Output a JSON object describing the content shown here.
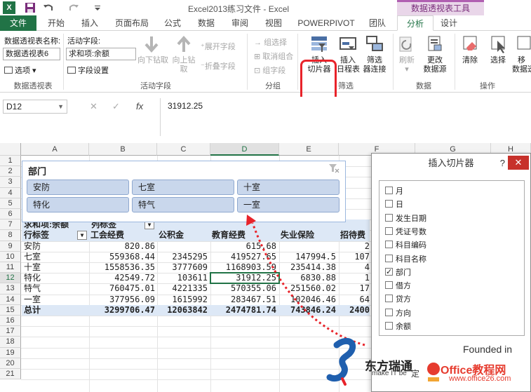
{
  "window": {
    "title": "Excel2013练习文件 - Excel",
    "context_tool": "数据透视表工具"
  },
  "tabs": [
    {
      "label": "文件"
    },
    {
      "label": "开始"
    },
    {
      "label": "插入"
    },
    {
      "label": "页面布局"
    },
    {
      "label": "公式"
    },
    {
      "label": "数据"
    },
    {
      "label": "审阅"
    },
    {
      "label": "视图"
    },
    {
      "label": "POWERPIVOT"
    },
    {
      "label": "团队"
    },
    {
      "label": "分析"
    },
    {
      "label": "设计"
    }
  ],
  "ribbon": {
    "pivot_name_label": "数据透视表名称:",
    "pivot_name_value": "数据透视表6",
    "options_label": "选项",
    "group_pivot": "数据透视表",
    "active_field_label": "活动字段:",
    "active_field_value": "求和项:余额",
    "field_settings": "字段设置",
    "drill_down": "向下钻取",
    "drill_up": "向上钻",
    "drill_up_2": "取",
    "expand_field": "展开字段",
    "collapse_field": "折叠字段",
    "group_active_field": "活动字段",
    "group_selection": "组选择",
    "ungroup": "取消组合",
    "group_field": "组字段",
    "group_group": "分组",
    "insert_slicer_1": "插入",
    "insert_slicer_2": "切片器",
    "insert_timeline_1": "插入",
    "insert_timeline_2": "日程表",
    "filter_conn_1": "筛选",
    "filter_conn_2": "器连接",
    "group_filter": "筛选",
    "refresh": "刷新",
    "change_source_1": "更改",
    "change_source_2": "数据源",
    "group_data": "数据",
    "clear": "清除",
    "select": "选择",
    "move_1": "移",
    "move_2": "数据透",
    "group_actions": "操作"
  },
  "formula_bar": {
    "name_box": "D12",
    "fx": "fx",
    "formula": "31912.25"
  },
  "columns": [
    "A",
    "B",
    "C",
    "D",
    "E",
    "F",
    "G",
    "H"
  ],
  "rows": [
    "1",
    "2",
    "3",
    "4",
    "5",
    "6",
    "7",
    "8",
    "9",
    "10",
    "11",
    "12",
    "13",
    "14",
    "15",
    "16",
    "17",
    "18",
    "19",
    "20",
    "21"
  ],
  "slicer": {
    "title": "部门",
    "items": [
      "安防",
      "七室",
      "十室",
      "特化",
      "特气",
      "一室"
    ]
  },
  "pivot": {
    "value_label": "求和项:余额",
    "col_label": "列标签",
    "row_label": "行标签",
    "headers": [
      "工会经费",
      "公积金",
      "教育经费",
      "失业保险",
      "招待费"
    ],
    "rows": [
      {
        "name": "安防",
        "values": [
          "820.86",
          "",
          "615.68",
          "",
          "2"
        ]
      },
      {
        "name": "七室",
        "values": [
          "559368.44",
          "2345295",
          "419527.65",
          "147994.5",
          "107"
        ]
      },
      {
        "name": "十室",
        "values": [
          "1558536.35",
          "3777609",
          "1168903.59",
          "235414.38",
          "4"
        ]
      },
      {
        "name": "特化",
        "values": [
          "42549.72",
          "103611",
          "31912.25",
          "6830.88",
          "1"
        ]
      },
      {
        "name": "特气",
        "values": [
          "760475.01",
          "4221335",
          "570355.06",
          "251560.02",
          "17"
        ]
      },
      {
        "name": "一室",
        "values": [
          "377956.09",
          "1615992",
          "283467.51",
          "102046.46",
          "64"
        ]
      }
    ],
    "total": {
      "name": "总计",
      "values": [
        "3299706.47",
        "12063842",
        "2474781.74",
        "743846.24",
        "2400"
      ]
    }
  },
  "dialog": {
    "title": "插入切片器",
    "help": "?",
    "close": "✕",
    "fields": [
      {
        "label": "月",
        "checked": false
      },
      {
        "label": "日",
        "checked": false
      },
      {
        "label": "发生日期",
        "checked": false
      },
      {
        "label": "凭证号数",
        "checked": false
      },
      {
        "label": "科目编码",
        "checked": false
      },
      {
        "label": "科目名称",
        "checked": false
      },
      {
        "label": "部门",
        "checked": true
      },
      {
        "label": "借方",
        "checked": false
      },
      {
        "label": "贷方",
        "checked": false
      },
      {
        "label": "方向",
        "checked": false
      },
      {
        "label": "余额",
        "checked": false
      }
    ],
    "footer_fragment": "定"
  },
  "watermark": {
    "brand": "东方瑞通",
    "tagline": "make IT be",
    "founded": "Founded in",
    "office26": "Office教程网",
    "office26_url": "www.office26.com"
  },
  "colors": {
    "excel_green": "#217346",
    "context_purple": "#b05fb1",
    "highlight_red": "#e8232a",
    "slicer_item": "#c9d7ec",
    "pivot_header": "#dde8f6"
  }
}
